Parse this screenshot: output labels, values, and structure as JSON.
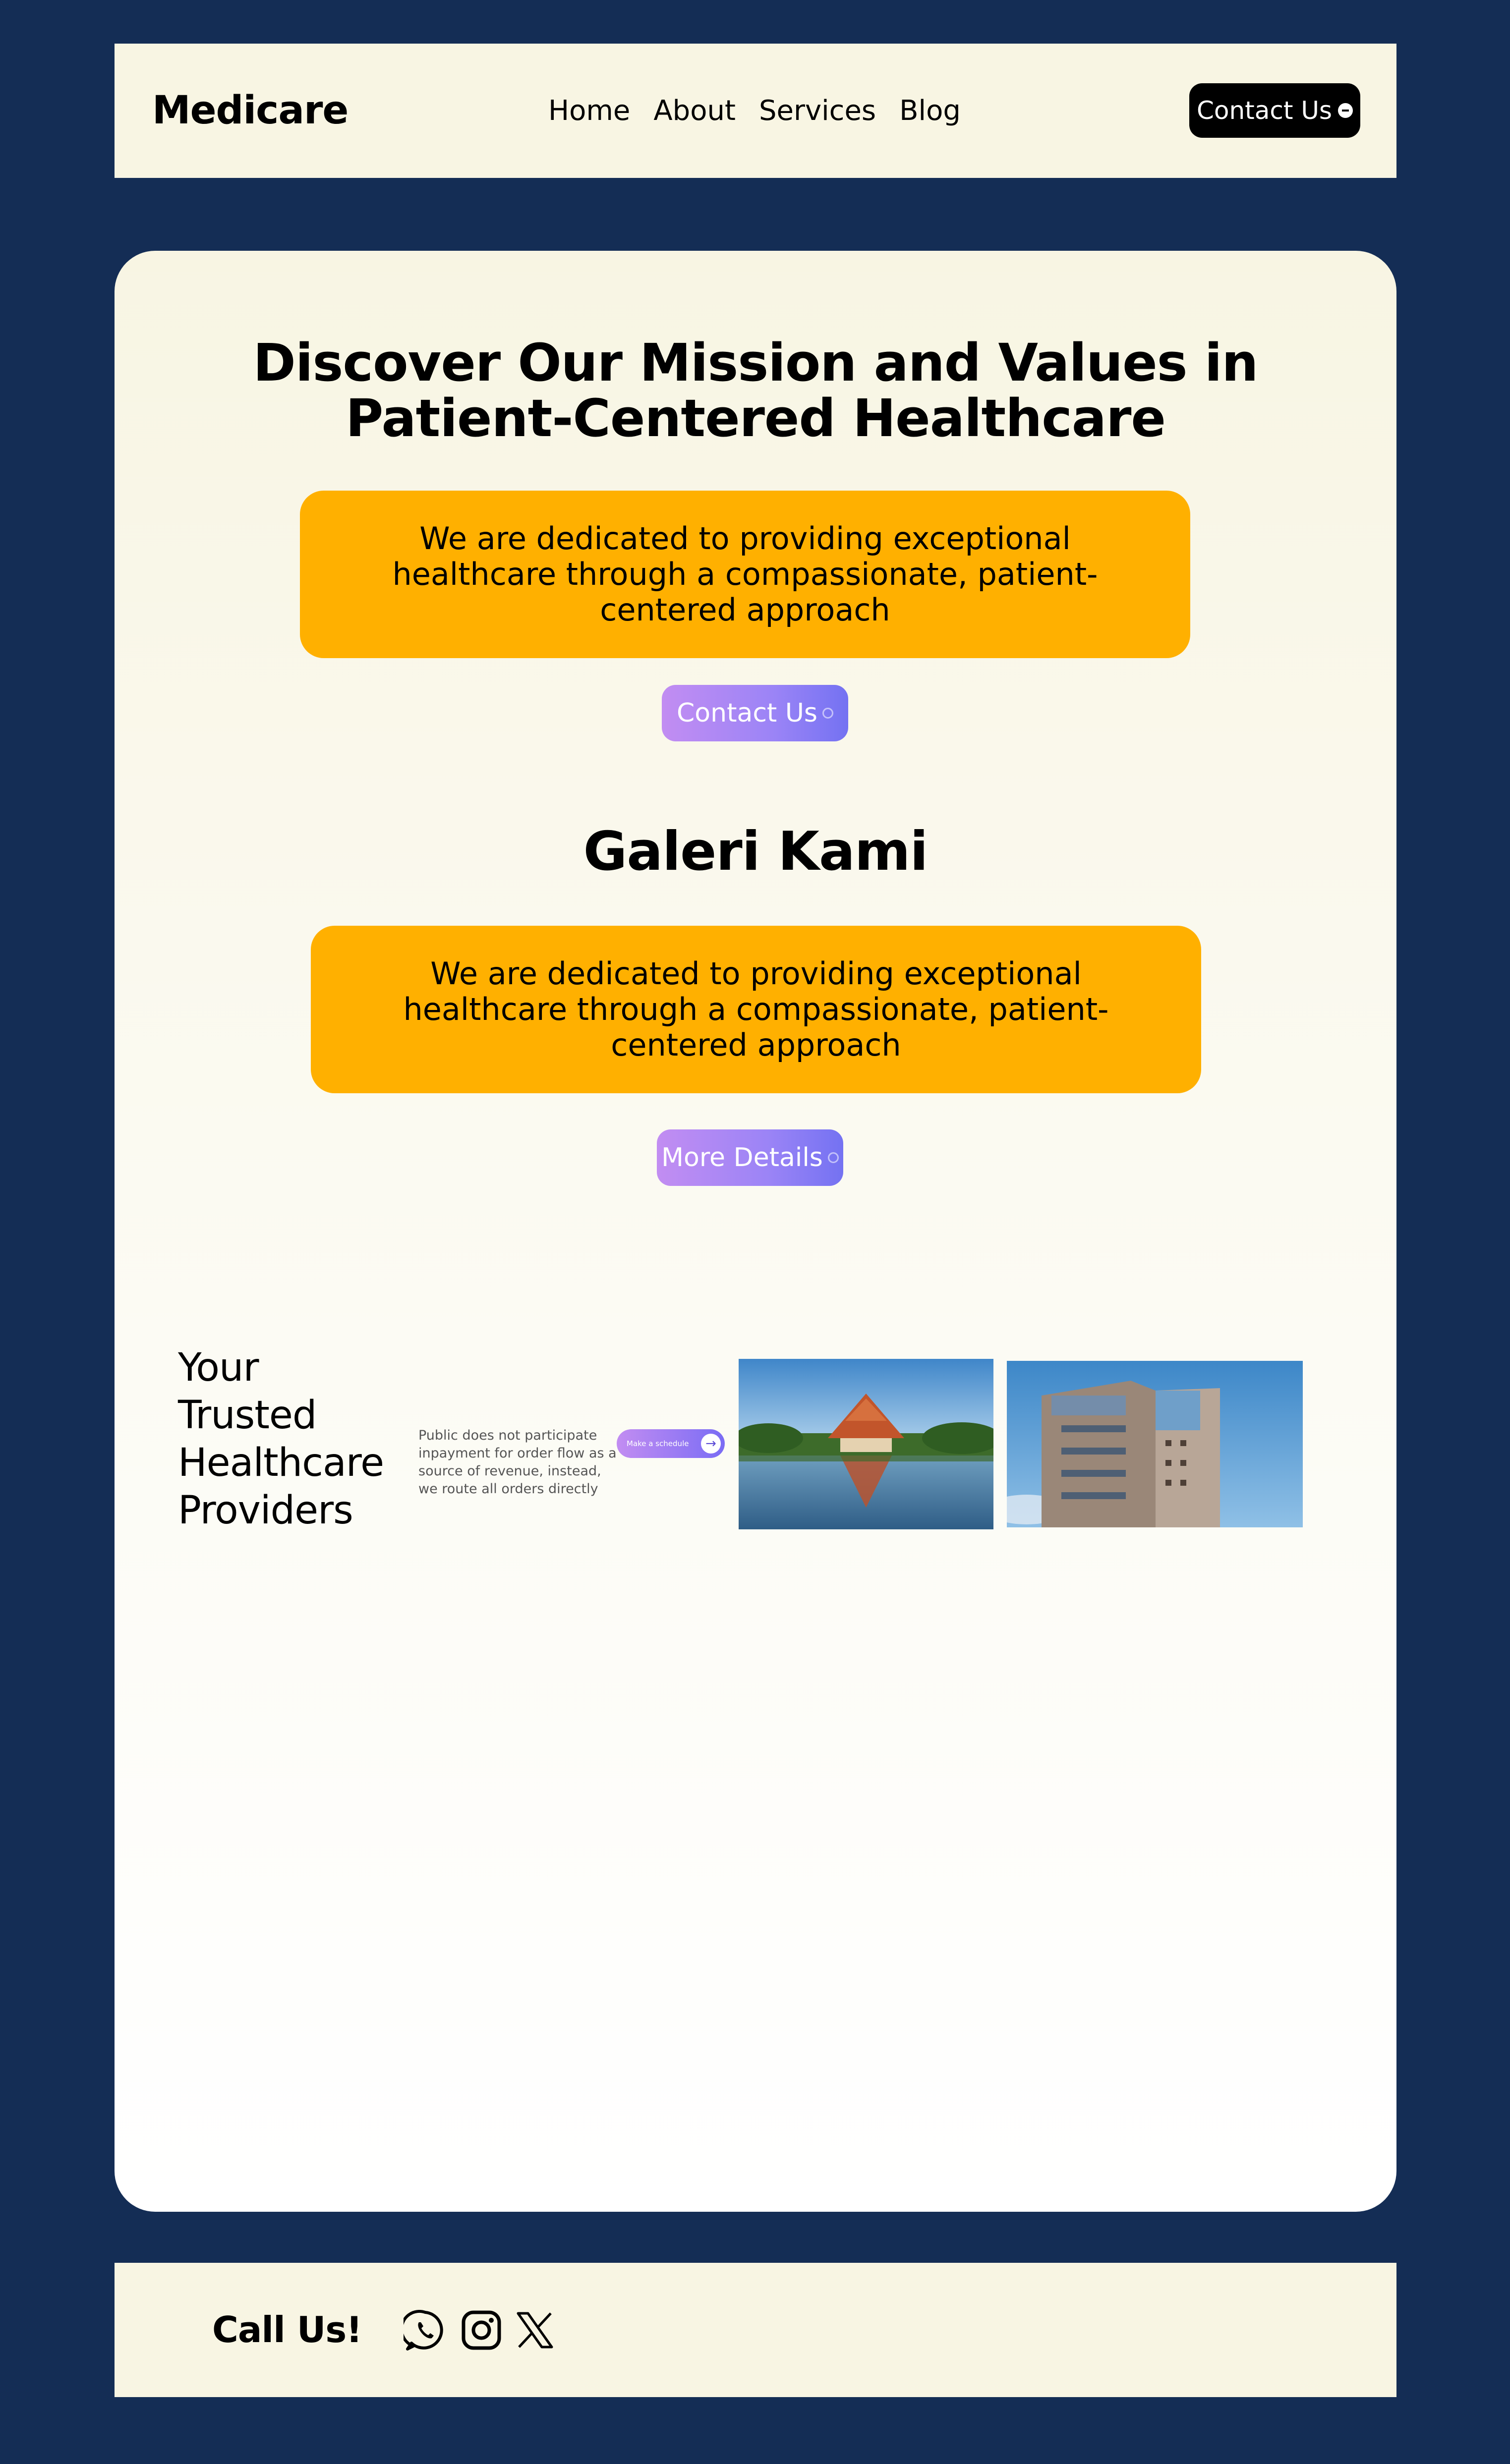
{
  "header": {
    "logo": "Medicare",
    "nav": [
      "Home",
      "About",
      "Services",
      "Blog"
    ],
    "cta_label": "Contact Us",
    "cta_icon": "dot-icon"
  },
  "hero": {
    "title_line1": "Discover Our Mission and Values in",
    "title_line2": "Patient-Centered Healthcare",
    "description": "We are dedicated to providing exceptional healthcare through a compassionate, patient-centered approach",
    "button_label": "Contact Us",
    "button_icon": "ring-icon"
  },
  "gallery": {
    "title": "Galeri Kami",
    "description": "We are dedicated to providing exceptional healthcare through a compassionate, patient-centered approach",
    "button_label": "More Details",
    "button_icon": "ring-icon"
  },
  "trusted": {
    "title_lines": [
      "Your",
      "Trusted",
      "Healthcare",
      "Providers"
    ],
    "text": "Public does not participate inpayment for order flow as a source of revenue, instead, we route all orders directly",
    "schedule_label": "Make a schedule",
    "schedule_icon": "arrow-right-icon",
    "images": [
      "pavilion-lake-photo",
      "modern-building-photo"
    ]
  },
  "footer": {
    "call_label": "Call Us!",
    "social_icons": [
      "whatsapp-icon",
      "instagram-icon",
      "x-icon"
    ]
  },
  "colors": {
    "page_background": "#142d55",
    "panel_background": "#f8f5e3",
    "highlight": "#ffb000",
    "button_gradient_start": "#c28df2",
    "button_gradient_end": "#7472f2",
    "cta_background": "#000000"
  }
}
